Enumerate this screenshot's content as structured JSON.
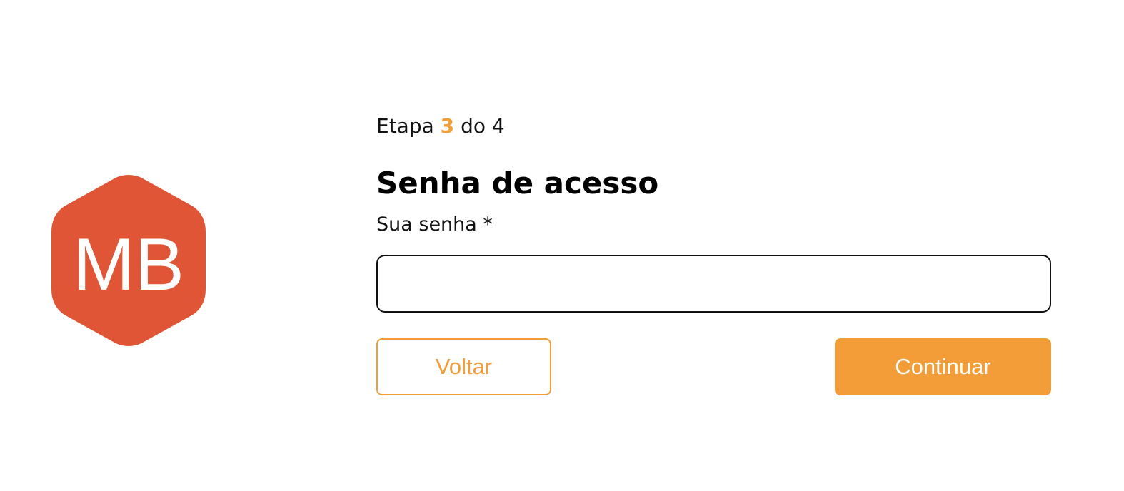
{
  "logo": {
    "text": "MB",
    "color": "#e05535",
    "text_color": "#ffffff"
  },
  "step": {
    "prefix": "Etapa",
    "current": "3",
    "separator": "do",
    "total": "4"
  },
  "form": {
    "title": "Senha de acesso",
    "password_label": "Sua senha *",
    "password_value": "",
    "password_placeholder": ""
  },
  "actions": {
    "back_label": "Voltar",
    "continue_label": "Continuar"
  },
  "colors": {
    "accent": "#f29d38",
    "logo": "#e05535",
    "text": "#111111"
  }
}
